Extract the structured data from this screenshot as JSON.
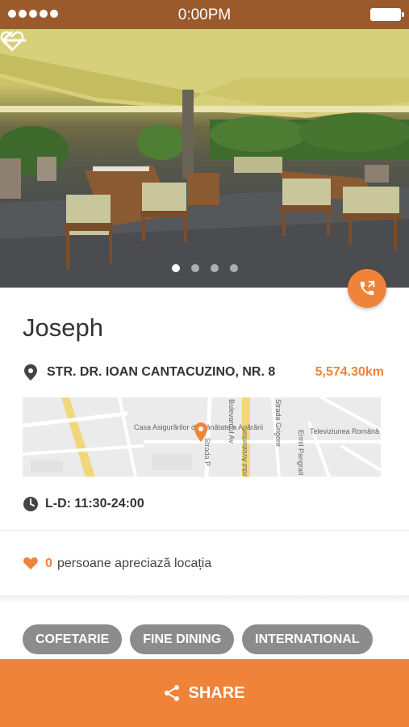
{
  "status_bar": {
    "time": "0:00PM"
  },
  "hero": {
    "slides_total": 4,
    "active_slide": 1
  },
  "place": {
    "name": "Joseph",
    "address": "STR. DR. IOAN CANTACUZINO, NR. 8",
    "distance": "5,574.30km",
    "hours": "L-D: 11:30-24:00",
    "likes_count": "0",
    "likes_label": "persoane apreciază locația"
  },
  "map": {
    "labels": {
      "casa": "Casa Asigurărilor de Sănătate a Apărării",
      "bulevardul": "Bulevardul Av",
      "aviatorilor": "Iardul Aviatorilor",
      "strada_grigore": "Strada Grigore",
      "strada_p": "Strada P",
      "pangrati": "Ermil Pangrati",
      "televiziunea": "Televiziunea Română"
    }
  },
  "tags": [
    "COFETARIE",
    "FINE DINING",
    "INTERNATIONAL"
  ],
  "share": {
    "label": "SHARE"
  },
  "colors": {
    "accent": "#f0833a",
    "status_bar": "#9a5a2c",
    "tag": "#8c8c8c"
  }
}
